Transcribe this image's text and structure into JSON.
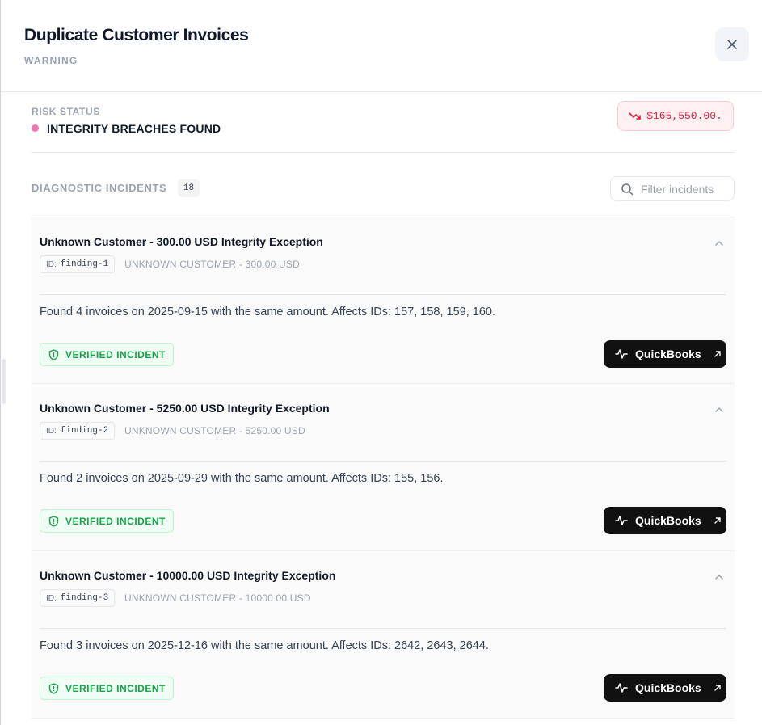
{
  "header": {
    "title": "Duplicate Customer Invoices",
    "severity": "WARNING"
  },
  "risk": {
    "label": "RISK STATUS",
    "status": "INTEGRITY BREACHES FOUND",
    "amount": "$165,550.00.",
    "trend_icon": "trending-down-icon"
  },
  "incidents": {
    "label": "DIAGNOSTIC INCIDENTS",
    "count": "18",
    "filter_placeholder": "Filter incidents",
    "items": [
      {
        "title": "Unknown Customer - 300.00 USD Integrity Exception",
        "id_label": "ID:",
        "id": "finding-1",
        "subtitle": "UNKNOWN CUSTOMER - 300.00 USD",
        "description": "Found 4 invoices on 2025-09-15 with the same amount. Affects IDs: 157, 158, 159, 160.",
        "badge": "VERIFIED INCIDENT",
        "action": "QuickBooks"
      },
      {
        "title": "Unknown Customer - 5250.00 USD Integrity Exception",
        "id_label": "ID:",
        "id": "finding-2",
        "subtitle": "UNKNOWN CUSTOMER - 5250.00 USD",
        "description": "Found 2 invoices on 2025-09-29 with the same amount. Affects IDs: 155, 156.",
        "badge": "VERIFIED INCIDENT",
        "action": "QuickBooks"
      },
      {
        "title": "Unknown Customer - 10000.00 USD Integrity Exception",
        "id_label": "ID:",
        "id": "finding-3",
        "subtitle": "UNKNOWN CUSTOMER - 10000.00 USD",
        "description": "Found 3 invoices on 2025-12-16 with the same amount. Affects IDs: 2642, 2643, 2644.",
        "badge": "VERIFIED INCIDENT",
        "action": "QuickBooks"
      }
    ]
  },
  "colors": {
    "accent_danger": "#e11d48",
    "status_dot": "#f472b6",
    "verified_green": "#16a34a",
    "button_dark": "#111111"
  }
}
